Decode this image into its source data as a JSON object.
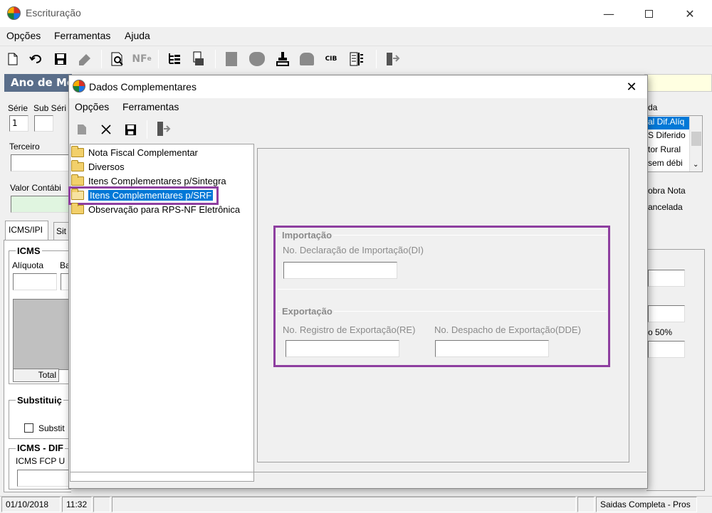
{
  "window": {
    "title": "Escrituração"
  },
  "menu": [
    "Opções",
    "Ferramentas",
    "Ajuda"
  ],
  "background_form": {
    "header": "Ano de Mo",
    "serie_label": "Série",
    "subserie_label": "Sub Séri",
    "serie_value": "1",
    "terceiro_label": "Terceiro",
    "valor_contabil_label": "Valor Contábi",
    "tab_icms_ipi": "ICMS/IPI",
    "tab_sit": "Sit",
    "icms_group": "ICMS",
    "aliquota_label": "Alíquota",
    "base_label": "Ba",
    "total_label": "Total",
    "substituicao_group": "Substituiç",
    "substit_checkbox": "Substit",
    "icms_dif_group": "ICMS - DIF",
    "icms_fcp_label": "ICMS FCP U",
    "right_list_header": "da",
    "right_list": [
      "al Dif.Alíq",
      "S Diferido",
      "tor Rural",
      "sem débi"
    ],
    "right_check1": "obra Nota",
    "right_check2": "ancelada",
    "right_pct_label": "o 50%"
  },
  "statusbar": {
    "date": "01/10/2018",
    "time": "11:32",
    "status": "Saidas Completa - Pros"
  },
  "dialog": {
    "title": "Dados Complementares",
    "menu": [
      "Opções",
      "Ferramentas"
    ],
    "close_glyph": "✕",
    "tree_items": [
      "Nota Fiscal Complementar",
      "Diversos",
      "Itens Complementares p/Sintegra",
      "Itens Complementares p/SRF",
      "Observação para RPS-NF Eletrônica"
    ],
    "selected_index": 3,
    "importacao": {
      "legend": "Importação",
      "di_label": "No. Declaração de Importação(DI)",
      "di_value": ""
    },
    "exportacao": {
      "legend": "Exportação",
      "re_label": "No. Registro de Exportação(RE)",
      "re_value": "",
      "dde_label": "No. Despacho de Exportação(DDE)",
      "dde_value": ""
    }
  },
  "colors": {
    "highlight": "#8e3fa0",
    "selection": "#0078d7",
    "header_strip": "#5a6e8a"
  }
}
